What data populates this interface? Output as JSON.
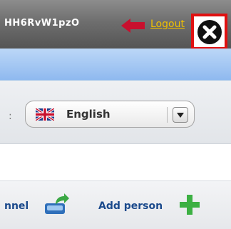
{
  "header": {
    "username": "HH6RvW1pzO",
    "logout_label": "Logout",
    "logout_icon": "left-arrow-icon",
    "close_icon": "close-icon"
  },
  "language": {
    "label_fragment": ":",
    "selected": "English",
    "flag_icon": "uk-flag-icon",
    "dropdown_icon": "chevron-down-icon"
  },
  "actions": {
    "channel_label_fragment": "nnel",
    "channel_icon": "channel-upload-icon",
    "add_person_label": "Add person",
    "add_person_icon": "plus-icon"
  },
  "colors": {
    "logout_link": "#f0c000",
    "close_highlight": "#e01010",
    "action_text": "#1b4a8c",
    "arrow_red": "#c8102e",
    "plus_green": "#3cb043"
  }
}
